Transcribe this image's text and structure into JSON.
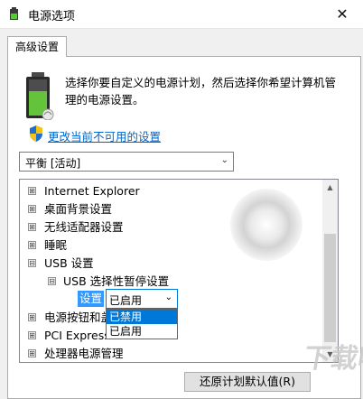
{
  "window": {
    "title": "电源选项",
    "close_glyph": "✕"
  },
  "tab": {
    "label": "高级设置"
  },
  "intro_text": "选择你要自定义的电源计划，然后选择你希望计算机管理的电源设置。",
  "change_link": "更改当前不可用的设置",
  "plan_select": {
    "value": "平衡 [活动]"
  },
  "tree": {
    "items": [
      {
        "expander": "⊞",
        "label": "Internet Explorer"
      },
      {
        "expander": "⊞",
        "label": "桌面背景设置"
      },
      {
        "expander": "⊞",
        "label": "无线适配器设置"
      },
      {
        "expander": "⊞",
        "label": "睡眠"
      },
      {
        "expander": "⊟",
        "label": "USB 设置"
      },
      {
        "expander": "⊟",
        "label": "USB 选择性暂停设置"
      },
      {
        "expander": "⊞",
        "label": "电源按钮和盖子"
      },
      {
        "expander": "⊞",
        "label": "PCI Express"
      },
      {
        "expander": "⊞",
        "label": "处理器电源管理"
      }
    ],
    "setting_label": "设置",
    "setting_value": "已启用",
    "dropdown_options": [
      "已禁用",
      "已启用"
    ],
    "dropdown_highlighted_index": 0
  },
  "restore_button": "还原计划默认值(R)",
  "watermark": "下载吧",
  "colors": {
    "accent": "#0078d7",
    "link": "#0066cc",
    "selection": "#3399ff"
  },
  "icons": [
    "power-options-icon",
    "battery-icon",
    "uac-shield-icon",
    "chevron-down-icon",
    "close-icon"
  ]
}
